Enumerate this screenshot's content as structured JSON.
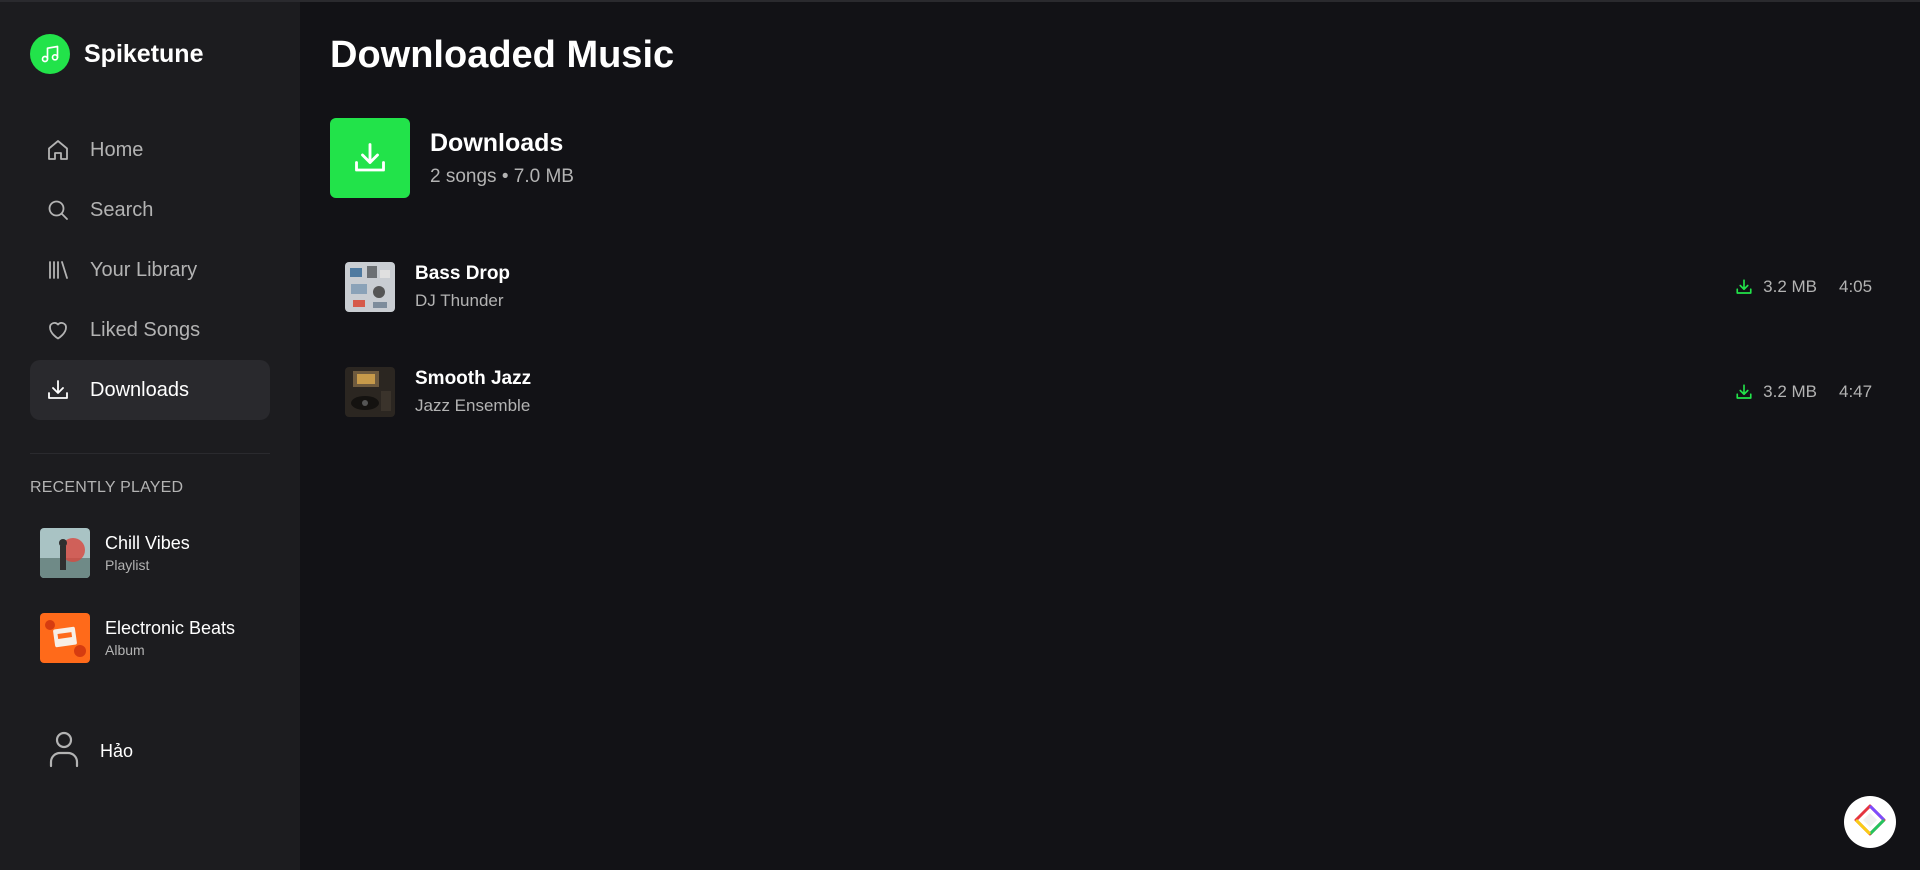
{
  "app": {
    "name": "Spiketune",
    "accent_color": "#22e34a",
    "logo_icon": "music-note-icon"
  },
  "sidebar": {
    "nav": [
      {
        "label": "Home",
        "icon": "home-icon",
        "active": false
      },
      {
        "label": "Search",
        "icon": "search-icon",
        "active": false
      },
      {
        "label": "Your Library",
        "icon": "library-icon",
        "active": false
      },
      {
        "label": "Liked Songs",
        "icon": "heart-icon",
        "active": false
      },
      {
        "label": "Downloads",
        "icon": "download-icon",
        "active": true
      }
    ],
    "recently_played_title": "RECENTLY PLAYED",
    "recently_played": [
      {
        "title": "Chill Vibes",
        "type": "Playlist"
      },
      {
        "title": "Electronic Beats",
        "type": "Album"
      }
    ],
    "user": {
      "name": "Hảo",
      "icon": "user-icon"
    }
  },
  "main": {
    "page_title": "Downloaded Music",
    "collection": {
      "title": "Downloads",
      "meta": "2 songs • 7.0 MB",
      "icon": "download-icon"
    },
    "tracks": [
      {
        "title": "Bass Drop",
        "artist": "DJ Thunder",
        "size": "3.2 MB",
        "duration": "4:05"
      },
      {
        "title": "Smooth Jazz",
        "artist": "Jazz Ensemble",
        "size": "3.2 MB",
        "duration": "4:47"
      }
    ]
  },
  "fab": {
    "icon": "diamond-logo-icon"
  }
}
